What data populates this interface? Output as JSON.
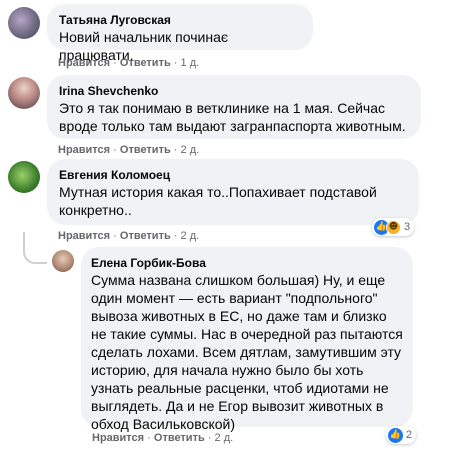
{
  "comments": [
    {
      "author": "Татьяна Луговская",
      "text": "Новий начальник починає працювати.",
      "like_label": "Нравится",
      "reply_label": "Ответить",
      "time": "1 д."
    },
    {
      "author": "Irina Shevchenko",
      "text": "Это я так понимаю в ветклинике на 1 мая. Сейчас вроде только там выдают загранпаспорта животным.",
      "like_label": "Нравится",
      "reply_label": "Ответить",
      "time": "2 д."
    },
    {
      "author": "Евгения Коломоец",
      "text": "Мутная история какая то..Попахивает подставой конкретно..",
      "like_label": "Нравится",
      "reply_label": "Ответить",
      "time": "2 д.",
      "reactions": {
        "icons": [
          "like-icon",
          "haha-icon"
        ],
        "count": "3"
      }
    }
  ],
  "reply": {
    "author": "Елена Горбик-Бова",
    "text": "Сумма названа слишком большая) Ну, и еще один момент — есть вариант \"подпольного\" вывоза животных в ЕС, но даже там и близко не такие суммы. Нас в очередной раз пытаются сделать лохами. Всем дятлам, замутившим эту историю, для начала нужно было бы хоть узнать реальные расценки, чтоб идиотами не выглядеть. Да и не Егор вывозит животных в обход Васильковской)",
    "like_label": "Нравится",
    "reply_label": "Ответить",
    "time": "2 д.",
    "reactions": {
      "icons": [
        "like-icon"
      ],
      "count": "2"
    }
  },
  "separator": "·",
  "colors": {
    "bubble": "#f0f2f5",
    "meta": "#65676b",
    "like": "#1877f2"
  }
}
